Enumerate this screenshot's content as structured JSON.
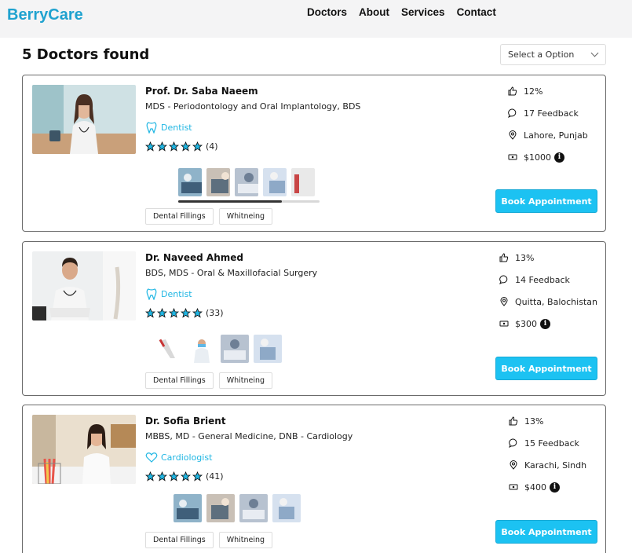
{
  "header": {
    "logo": "BerryCare",
    "nav": [
      "Doctors",
      "About",
      "Services",
      "Contact"
    ]
  },
  "results": {
    "title": "5 Doctors found",
    "select_value": "Select a Option"
  },
  "colors": {
    "brand": "#1fa2cf",
    "accent": "#1cc2f2",
    "star": "#1fb6e3"
  },
  "doctors": [
    {
      "name": "Prof. Dr. Saba Naeem",
      "degree": "MDS - Periodontology and Oral Implantology, BDS",
      "specialty": "Dentist",
      "specialty_icon": "tooth-icon",
      "rating_stars": 5,
      "reviews": "(4)",
      "likes": "12%",
      "feedback": "17 Feedback",
      "location": "Lahore, Punjab",
      "fee": "$1000",
      "tags": [
        "Dental Fillings",
        "Whitneing"
      ],
      "gallery_scroll_fraction": 0.6,
      "book_label": "Book Appointment"
    },
    {
      "name": "Dr. Naveed Ahmed",
      "degree": "BDS, MDS - Oral & Maxillofacial Surgery",
      "specialty": "Dentist",
      "specialty_icon": "tooth-icon",
      "rating_stars": 5,
      "reviews": "(33)",
      "likes": "13%",
      "feedback": "14 Feedback",
      "location": "Quitta, Balochistan",
      "fee": "$300",
      "tags": [
        "Dental Fillings",
        "Whitneing"
      ],
      "book_label": "Book Appointment"
    },
    {
      "name": "Dr. Sofia Brient",
      "degree": "MBBS, MD - General Medicine, DNB - Cardiology",
      "specialty": "Cardiologist",
      "specialty_icon": "heart-icon",
      "rating_stars": 5,
      "reviews": "(41)",
      "likes": "13%",
      "feedback": "15 Feedback",
      "location": "Karachi, Sindh",
      "fee": "$400",
      "tags": [
        "Dental Fillings",
        "Whitneing"
      ],
      "book_label": "Book Appointment"
    }
  ]
}
